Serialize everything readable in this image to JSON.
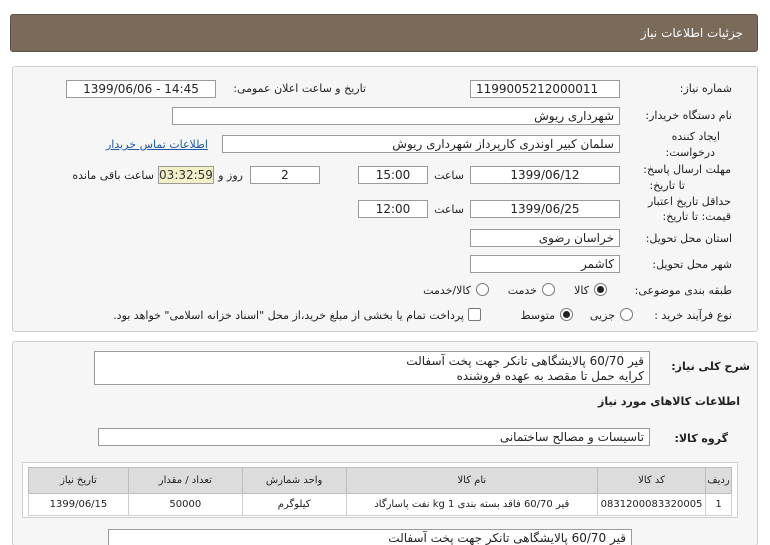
{
  "header": {
    "title": "جزئیات اطلاعات نیاز"
  },
  "fields": {
    "need_number_label": "شماره نیاز:",
    "need_number": "1199005212000011",
    "announce_label": "تاریخ و ساعت اعلان عمومی:",
    "announce_value": "1399/06/06 - 14:45",
    "buyer_org_label": "نام دستگاه خریدار:",
    "buyer_org": "شهرداری ریوش",
    "creator_label": "ایجاد کننده درخواست:",
    "creator": "سلمان کبیر اوندری کارپرداز شهرداری ریوش",
    "contact_link": "اطلاعات تماس خریدار",
    "reply_deadline_label": "مهلت ارسال پاسخ: تا تاریخ:",
    "reply_date": "1399/06/12",
    "time_label": "ساعت",
    "reply_time": "15:00",
    "days_value": "2",
    "days_label": "روز و",
    "timer_value": "03:32:59",
    "remaining_label": "ساعت باقی مانده",
    "validity_label": "حداقل تاریخ اعتبار قیمت: تا تاریخ:",
    "validity_date": "1399/06/25",
    "validity_time": "12:00",
    "province_label": "استان محل تحویل:",
    "province": "خراسان رضوی",
    "city_label": "شهر محل تحویل:",
    "city": "کاشمر",
    "category_label": "طبقه بندی موضوعی:",
    "category_options": [
      "کالا",
      "خدمت",
      "کالا/خدمت"
    ],
    "category_selected": "کالا",
    "process_label": "نوع فرآیند خرید :",
    "process_options": [
      "جزیی",
      "متوسط"
    ],
    "process_selected": "متوسط",
    "payment_note": "پرداخت تمام یا بخشی از مبلغ خرید،از محل \"اسناد خزانه اسلامی\" خواهد بود."
  },
  "description": {
    "label": "شرح کلی نیاز:",
    "line1": "قیر 60/70 پالایشگاهی تانکر جهت پخت آسفالت",
    "line2": "کرایه حمل  تا مقصد به عهده فروشنده"
  },
  "goods_info": {
    "title": "اطلاعات کالاهای مورد نیاز",
    "group_label": "گروه کالا:",
    "group_value": "تاسیسات و مصالح ساختمانی"
  },
  "table": {
    "headers": [
      "ردیف",
      "کد کالا",
      "نام کالا",
      "واحد شمارش",
      "تعداد / مقدار",
      "تاریخ نیاز"
    ],
    "rows": [
      [
        "1",
        "0831200083320005",
        "قیر 60/70 فاقد بسته بندی 1 kg نفت پاسارگاد",
        "کیلوگرم",
        "50000",
        "1399/06/15"
      ]
    ]
  },
  "bottom_desc": "قیر 60/70 پالایشگاهی تانکر جهت پخت آسفالت"
}
